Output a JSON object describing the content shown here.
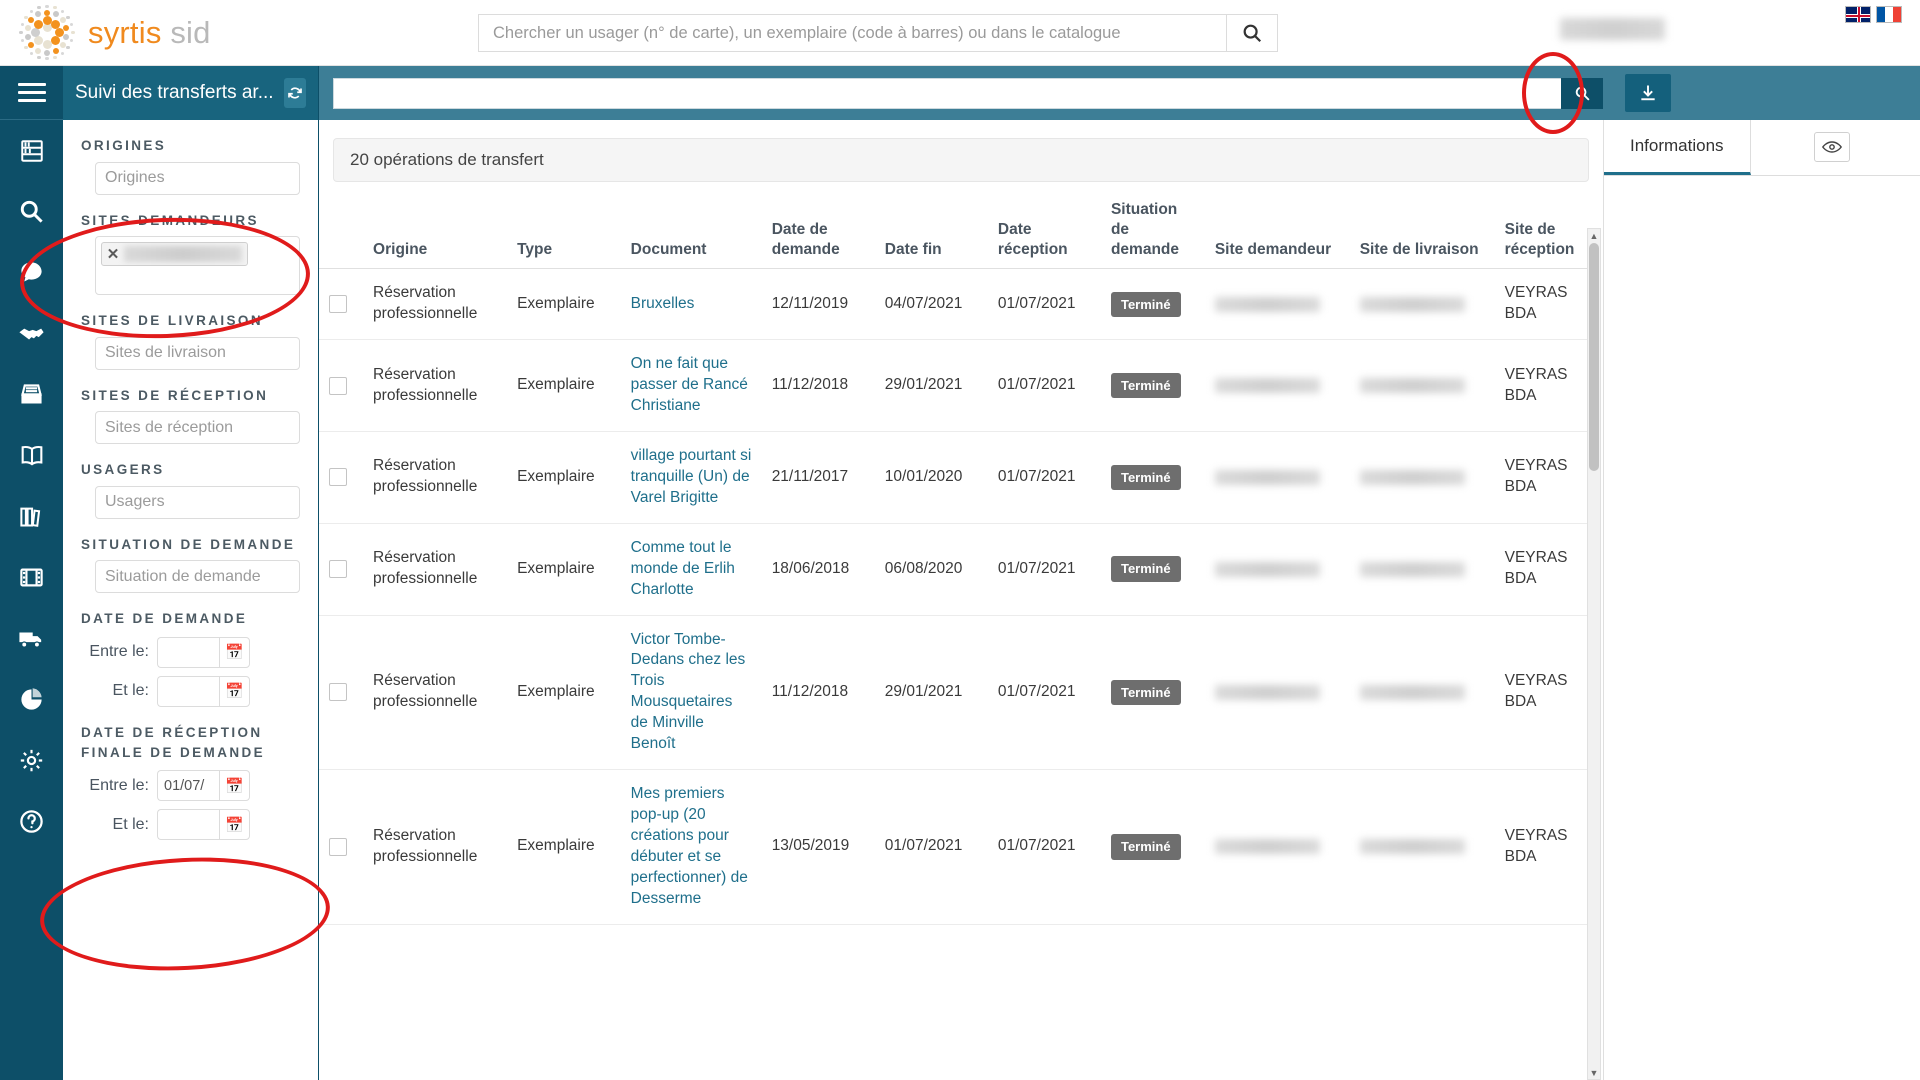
{
  "app": {
    "logo_primary": "syrtis",
    "logo_secondary": "sid",
    "accent_teal": "#0d4f68",
    "accent_orange": "#f08a1e",
    "toolbar_teal": "#3d7e96"
  },
  "global_search": {
    "placeholder": "Chercher un usager (n° de carte), un exemplaire (code à barres) ou dans le catalogue",
    "value": "",
    "button_icon": "search-icon"
  },
  "languages": [
    {
      "name": "english-flag"
    },
    {
      "name": "french-flag"
    }
  ],
  "rail": {
    "menu_icon": "hamburger-menu-icon",
    "items": [
      {
        "icon": "archive-shelf-icon",
        "label": "Archives"
      },
      {
        "icon": "search-icon",
        "label": "Recherche"
      },
      {
        "icon": "speech-bubble-icon",
        "label": "Messages"
      },
      {
        "icon": "handshake-icon",
        "label": "Prêts"
      },
      {
        "icon": "drawer-icon",
        "label": "Documents"
      },
      {
        "icon": "open-book-icon",
        "label": "Catalogue"
      },
      {
        "icon": "bookshelf-icon",
        "label": "Collections"
      },
      {
        "icon": "film-strip-icon",
        "label": "Médias"
      },
      {
        "icon": "truck-icon",
        "label": "Transferts"
      },
      {
        "icon": "pie-chart-icon",
        "label": "Statistiques"
      },
      {
        "icon": "gear-icon",
        "label": "Paramètres"
      },
      {
        "icon": "help-circle-icon",
        "label": "Aide"
      }
    ]
  },
  "filter_panel": {
    "title": "Suivi des transferts ar...",
    "refresh_icon": "refresh-icon",
    "sections": {
      "origines": {
        "label": "ORIGINES",
        "placeholder": "Origines",
        "value": ""
      },
      "sites_demandeurs": {
        "label": "SITES DEMANDEURS",
        "tag_remove_icon": "close-icon",
        "tag_value": ""
      },
      "sites_livraison": {
        "label": "SITES DE LIVRAISON",
        "placeholder": "Sites de livraison",
        "value": ""
      },
      "sites_reception": {
        "label": "SITES DE RÉCEPTION",
        "placeholder": "Sites de réception",
        "value": ""
      },
      "usagers": {
        "label": "USAGERS",
        "placeholder": "Usagers",
        "value": ""
      },
      "situation_demande": {
        "label": "SITUATION DE DEMANDE",
        "placeholder": "Situation de demande",
        "value": ""
      },
      "date_demande": {
        "label": "DATE DE DEMANDE",
        "from_label": "Entre le:",
        "to_label": "Et le:",
        "from_value": "",
        "to_value": "",
        "calendar_icon": "calendar-icon"
      },
      "date_reception_finale": {
        "label": "DATE DE RÉCEPTION FINALE DE DEMANDE",
        "from_label": "Entre le:",
        "to_label": "Et le:",
        "from_value": "01/07/",
        "to_value": "",
        "calendar_icon": "calendar-icon"
      }
    }
  },
  "main_toolbar": {
    "search_value": "",
    "search_placeholder": "",
    "search_icon": "search-icon",
    "download_icon": "download-icon"
  },
  "results": {
    "count_text": "20 opérations de transfert",
    "columns": [
      "",
      "Origine",
      "Type",
      "Document",
      "Date de demande",
      "Date fin",
      "Date réception",
      "Situation de demande",
      "Site demandeur",
      "Site de livraison",
      "Site de réception"
    ],
    "rows": [
      {
        "origine": "Réservation professionnelle",
        "type": "Exemplaire",
        "document": "Bruxelles",
        "date_demande": "12/11/2019",
        "date_fin": "04/07/2021",
        "date_reception": "01/07/2021",
        "situation": "Terminé",
        "site_demandeur": "",
        "site_livraison": "",
        "site_reception": "VEYRAS BDA"
      },
      {
        "origine": "Réservation professionnelle",
        "type": "Exemplaire",
        "document": "On ne fait que passer de Rancé Christiane",
        "date_demande": "11/12/2018",
        "date_fin": "29/01/2021",
        "date_reception": "01/07/2021",
        "situation": "Terminé",
        "site_demandeur": "",
        "site_livraison": "",
        "site_reception": "VEYRAS BDA"
      },
      {
        "origine": "Réservation professionnelle",
        "type": "Exemplaire",
        "document": "village pourtant si tranquille (Un) de Varel Brigitte",
        "date_demande": "21/11/2017",
        "date_fin": "10/01/2020",
        "date_reception": "01/07/2021",
        "situation": "Terminé",
        "site_demandeur": "",
        "site_livraison": "",
        "site_reception": "VEYRAS BDA"
      },
      {
        "origine": "Réservation professionnelle",
        "type": "Exemplaire",
        "document": "Comme tout le monde de Erlih Charlotte",
        "date_demande": "18/06/2018",
        "date_fin": "06/08/2020",
        "date_reception": "01/07/2021",
        "situation": "Terminé",
        "site_demandeur": "",
        "site_livraison": "",
        "site_reception": "VEYRAS BDA"
      },
      {
        "origine": "Réservation professionnelle",
        "type": "Exemplaire",
        "document": "Victor Tombe-Dedans chez les Trois Mousquetaires de Minville Benoît",
        "date_demande": "11/12/2018",
        "date_fin": "29/01/2021",
        "date_reception": "01/07/2021",
        "situation": "Terminé",
        "site_demandeur": "",
        "site_livraison": "",
        "site_reception": "VEYRAS BDA"
      },
      {
        "origine": "Réservation professionnelle",
        "type": "Exemplaire",
        "document": "Mes premiers pop-up (20 créations pour débuter et se perfectionner) de Desserme",
        "date_demande": "13/05/2019",
        "date_fin": "01/07/2021",
        "date_reception": "01/07/2021",
        "situation": "Terminé",
        "site_demandeur": "",
        "site_livraison": "",
        "site_reception": "VEYRAS BDA"
      }
    ]
  },
  "info_panel": {
    "tab_label": "Informations",
    "eye_icon": "eye-icon"
  }
}
